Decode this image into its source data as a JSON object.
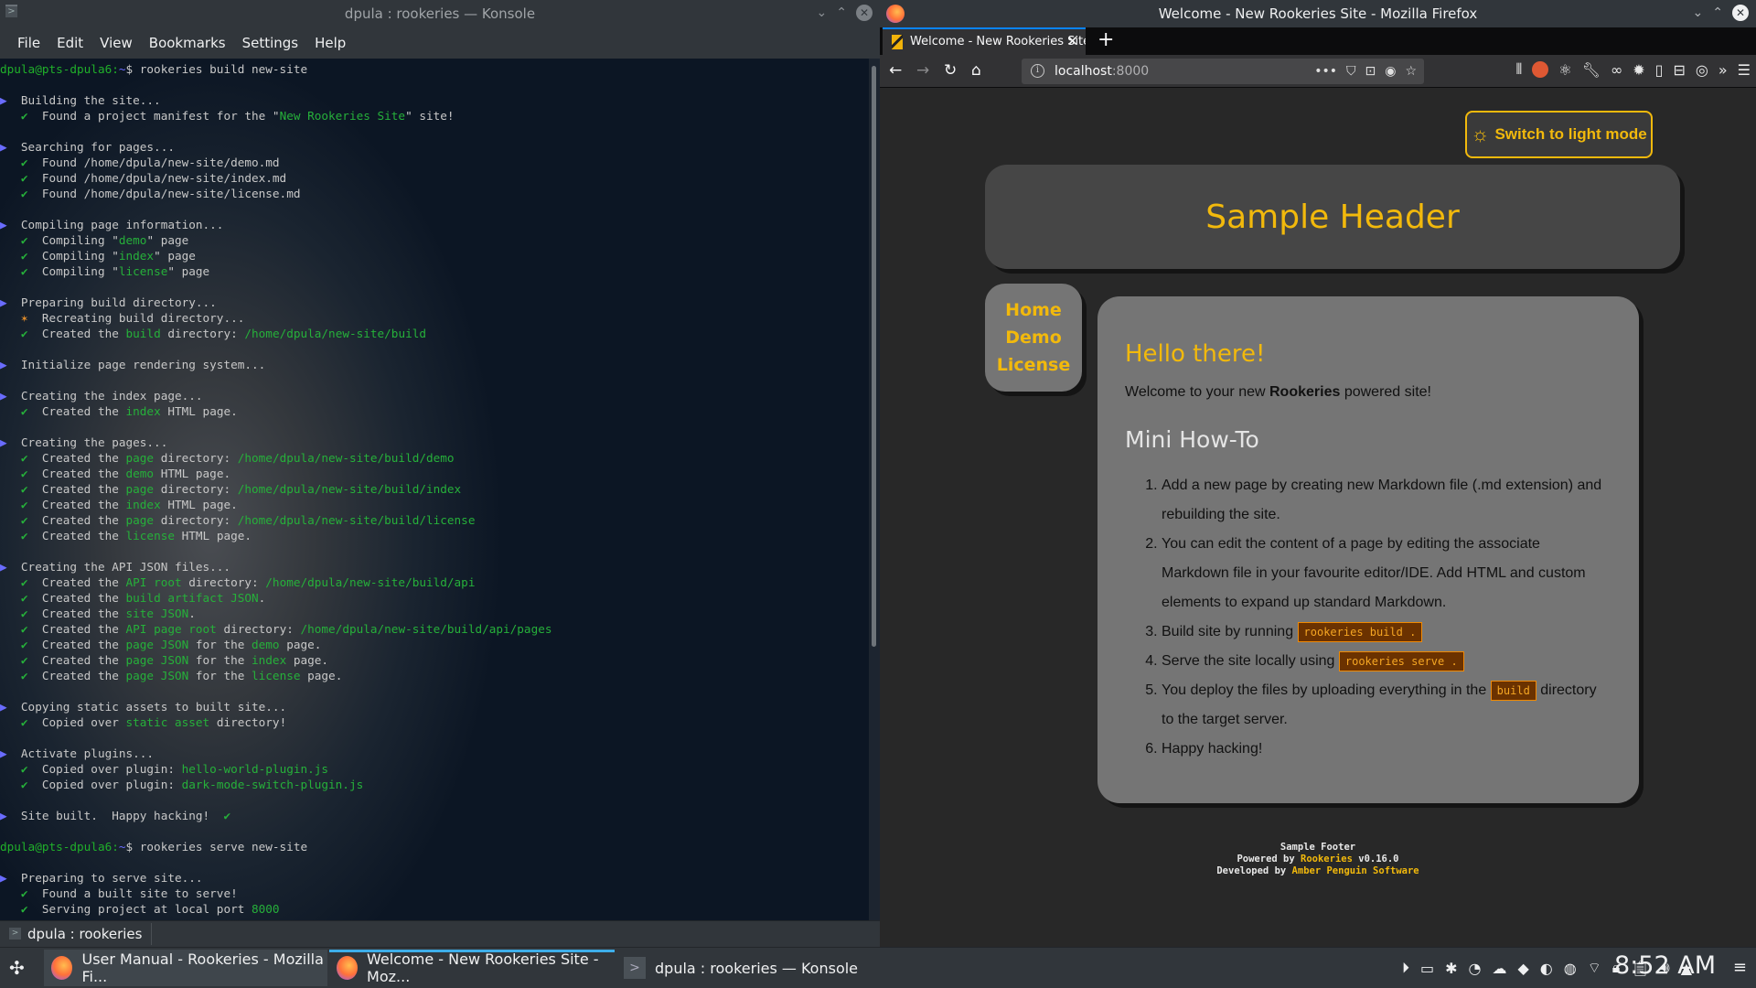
{
  "konsole": {
    "title": "dpula : rookeries — Konsole",
    "menu": [
      "File",
      "Edit",
      "View",
      "Bookmarks",
      "Settings",
      "Help"
    ],
    "tab_label": "dpula : rookeries",
    "lines": [
      [
        {
          "t": "dpula@pts-dpula6:",
          "c": "p"
        },
        {
          "t": "~",
          "c": "b"
        },
        {
          "t": "$ rookeries build new-site",
          "c": ""
        }
      ],
      [],
      [
        {
          "t": "▶ ",
          "c": "b"
        },
        {
          "t": " Building the site...",
          "c": ""
        }
      ],
      [
        {
          "t": "   ✔ ",
          "c": "g"
        },
        {
          "t": " Found a project manifest for the \"",
          "c": ""
        },
        {
          "t": "New Rookeries Site",
          "c": "g"
        },
        {
          "t": "\" site!",
          "c": ""
        }
      ],
      [],
      [
        {
          "t": "▶ ",
          "c": "b"
        },
        {
          "t": " Searching for pages...",
          "c": ""
        }
      ],
      [
        {
          "t": "   ✔ ",
          "c": "g"
        },
        {
          "t": " Found /home/dpula/new-site/demo.md",
          "c": ""
        }
      ],
      [
        {
          "t": "   ✔ ",
          "c": "g"
        },
        {
          "t": " Found /home/dpula/new-site/index.md",
          "c": ""
        }
      ],
      [
        {
          "t": "   ✔ ",
          "c": "g"
        },
        {
          "t": " Found /home/dpula/new-site/license.md",
          "c": ""
        }
      ],
      [],
      [
        {
          "t": "▶ ",
          "c": "b"
        },
        {
          "t": " Compiling page information...",
          "c": ""
        }
      ],
      [
        {
          "t": "   ✔ ",
          "c": "g"
        },
        {
          "t": " Compiling \"",
          "c": ""
        },
        {
          "t": "demo",
          "c": "g"
        },
        {
          "t": "\" page",
          "c": ""
        }
      ],
      [
        {
          "t": "   ✔ ",
          "c": "g"
        },
        {
          "t": " Compiling \"",
          "c": ""
        },
        {
          "t": "index",
          "c": "g"
        },
        {
          "t": "\" page",
          "c": ""
        }
      ],
      [
        {
          "t": "   ✔ ",
          "c": "g"
        },
        {
          "t": " Compiling \"",
          "c": ""
        },
        {
          "t": "license",
          "c": "g"
        },
        {
          "t": "\" page",
          "c": ""
        }
      ],
      [],
      [
        {
          "t": "▶ ",
          "c": "b"
        },
        {
          "t": " Preparing build directory...",
          "c": ""
        }
      ],
      [
        {
          "t": "   ✶ ",
          "c": "o"
        },
        {
          "t": " Recreating build directory...",
          "c": ""
        }
      ],
      [
        {
          "t": "   ✔ ",
          "c": "g"
        },
        {
          "t": " Created the ",
          "c": ""
        },
        {
          "t": "build",
          "c": "g"
        },
        {
          "t": " directory: ",
          "c": ""
        },
        {
          "t": "/home/dpula/new-site/build",
          "c": "g"
        }
      ],
      [],
      [
        {
          "t": "▶ ",
          "c": "b"
        },
        {
          "t": " Initialize page rendering system...",
          "c": ""
        }
      ],
      [],
      [
        {
          "t": "▶ ",
          "c": "b"
        },
        {
          "t": " Creating the index page...",
          "c": ""
        }
      ],
      [
        {
          "t": "   ✔ ",
          "c": "g"
        },
        {
          "t": " Created the ",
          "c": ""
        },
        {
          "t": "index",
          "c": "g"
        },
        {
          "t": " HTML page.",
          "c": ""
        }
      ],
      [],
      [
        {
          "t": "▶ ",
          "c": "b"
        },
        {
          "t": " Creating the pages...",
          "c": ""
        }
      ],
      [
        {
          "t": "   ✔ ",
          "c": "g"
        },
        {
          "t": " Created the ",
          "c": ""
        },
        {
          "t": "page",
          "c": "g"
        },
        {
          "t": " directory: ",
          "c": ""
        },
        {
          "t": "/home/dpula/new-site/build/demo",
          "c": "g"
        }
      ],
      [
        {
          "t": "   ✔ ",
          "c": "g"
        },
        {
          "t": " Created the ",
          "c": ""
        },
        {
          "t": "demo",
          "c": "g"
        },
        {
          "t": " HTML page.",
          "c": ""
        }
      ],
      [
        {
          "t": "   ✔ ",
          "c": "g"
        },
        {
          "t": " Created the ",
          "c": ""
        },
        {
          "t": "page",
          "c": "g"
        },
        {
          "t": " directory: ",
          "c": ""
        },
        {
          "t": "/home/dpula/new-site/build/index",
          "c": "g"
        }
      ],
      [
        {
          "t": "   ✔ ",
          "c": "g"
        },
        {
          "t": " Created the ",
          "c": ""
        },
        {
          "t": "index",
          "c": "g"
        },
        {
          "t": " HTML page.",
          "c": ""
        }
      ],
      [
        {
          "t": "   ✔ ",
          "c": "g"
        },
        {
          "t": " Created the ",
          "c": ""
        },
        {
          "t": "page",
          "c": "g"
        },
        {
          "t": " directory: ",
          "c": ""
        },
        {
          "t": "/home/dpula/new-site/build/license",
          "c": "g"
        }
      ],
      [
        {
          "t": "   ✔ ",
          "c": "g"
        },
        {
          "t": " Created the ",
          "c": ""
        },
        {
          "t": "license",
          "c": "g"
        },
        {
          "t": " HTML page.",
          "c": ""
        }
      ],
      [],
      [
        {
          "t": "▶ ",
          "c": "b"
        },
        {
          "t": " Creating the API JSON files...",
          "c": ""
        }
      ],
      [
        {
          "t": "   ✔ ",
          "c": "g"
        },
        {
          "t": " Created the ",
          "c": ""
        },
        {
          "t": "API root",
          "c": "g"
        },
        {
          "t": " directory: ",
          "c": ""
        },
        {
          "t": "/home/dpula/new-site/build/api",
          "c": "g"
        }
      ],
      [
        {
          "t": "   ✔ ",
          "c": "g"
        },
        {
          "t": " Created the ",
          "c": ""
        },
        {
          "t": "build artifact JSON",
          "c": "g"
        },
        {
          "t": ".",
          "c": ""
        }
      ],
      [
        {
          "t": "   ✔ ",
          "c": "g"
        },
        {
          "t": " Created the ",
          "c": ""
        },
        {
          "t": "site JSON",
          "c": "g"
        },
        {
          "t": ".",
          "c": ""
        }
      ],
      [
        {
          "t": "   ✔ ",
          "c": "g"
        },
        {
          "t": " Created the ",
          "c": ""
        },
        {
          "t": "API page root",
          "c": "g"
        },
        {
          "t": " directory: ",
          "c": ""
        },
        {
          "t": "/home/dpula/new-site/build/api/pages",
          "c": "g"
        }
      ],
      [
        {
          "t": "   ✔ ",
          "c": "g"
        },
        {
          "t": " Created the ",
          "c": ""
        },
        {
          "t": "page JSON",
          "c": "g"
        },
        {
          "t": " for the ",
          "c": ""
        },
        {
          "t": "demo",
          "c": "g"
        },
        {
          "t": " page.",
          "c": ""
        }
      ],
      [
        {
          "t": "   ✔ ",
          "c": "g"
        },
        {
          "t": " Created the ",
          "c": ""
        },
        {
          "t": "page JSON",
          "c": "g"
        },
        {
          "t": " for the ",
          "c": ""
        },
        {
          "t": "index",
          "c": "g"
        },
        {
          "t": " page.",
          "c": ""
        }
      ],
      [
        {
          "t": "   ✔ ",
          "c": "g"
        },
        {
          "t": " Created the ",
          "c": ""
        },
        {
          "t": "page JSON",
          "c": "g"
        },
        {
          "t": " for the ",
          "c": ""
        },
        {
          "t": "license",
          "c": "g"
        },
        {
          "t": " page.",
          "c": ""
        }
      ],
      [],
      [
        {
          "t": "▶ ",
          "c": "b"
        },
        {
          "t": " Copying static assets to built site...",
          "c": ""
        }
      ],
      [
        {
          "t": "   ✔ ",
          "c": "g"
        },
        {
          "t": " Copied over ",
          "c": ""
        },
        {
          "t": "static asset",
          "c": "g"
        },
        {
          "t": " directory!",
          "c": ""
        }
      ],
      [],
      [
        {
          "t": "▶ ",
          "c": "b"
        },
        {
          "t": " Activate plugins...",
          "c": ""
        }
      ],
      [
        {
          "t": "   ✔ ",
          "c": "g"
        },
        {
          "t": " Copied over plugin: ",
          "c": ""
        },
        {
          "t": "hello-world-plugin.js",
          "c": "g"
        }
      ],
      [
        {
          "t": "   ✔ ",
          "c": "g"
        },
        {
          "t": " Copied over plugin: ",
          "c": ""
        },
        {
          "t": "dark-mode-switch-plugin.js",
          "c": "g"
        }
      ],
      [],
      [
        {
          "t": "▶ ",
          "c": "b"
        },
        {
          "t": " Site built.  Happy hacking!  ",
          "c": ""
        },
        {
          "t": "✔",
          "c": "g"
        }
      ],
      [],
      [
        {
          "t": "dpula@pts-dpula6:",
          "c": "p"
        },
        {
          "t": "~",
          "c": "b"
        },
        {
          "t": "$ rookeries serve new-site",
          "c": ""
        }
      ],
      [],
      [
        {
          "t": "▶ ",
          "c": "b"
        },
        {
          "t": " Preparing to serve site...",
          "c": ""
        }
      ],
      [
        {
          "t": "   ✔ ",
          "c": "g"
        },
        {
          "t": " Found a built site to serve!",
          "c": ""
        }
      ],
      [
        {
          "t": "   ✔ ",
          "c": "g"
        },
        {
          "t": " Serving project at local port ",
          "c": ""
        },
        {
          "t": "8000",
          "c": "g"
        }
      ]
    ]
  },
  "firefox": {
    "title": "Welcome - New Rookeries Site - Mozilla Firefox",
    "tab_title": "Welcome - New Rookeries Site",
    "url_host": "localhost",
    "url_port": ":8000"
  },
  "page": {
    "mode_button": "Switch to light mode",
    "header": "Sample Header",
    "nav": [
      "Home",
      "Demo",
      "License"
    ],
    "heading": "Hello there!",
    "welcome_pre": "Welcome to your new ",
    "welcome_bold": "Rookeries",
    "welcome_post": " powered site!",
    "subheading": "Mini How-To",
    "steps": {
      "s1": "Add a new page by creating new Markdown file (.md extension) and rebuilding the site.",
      "s2": "You can edit the content of a page by editing the associate Markdown file in your favourite editor/IDE. Add HTML and custom elements to expand up standard Markdown.",
      "s3_pre": "Build site by running ",
      "s3_code": "rookeries build .",
      "s4_pre": "Serve the site locally using ",
      "s4_code": "rookeries serve .",
      "s5_pre": "You deploy the files by uploading everything in the ",
      "s5_code": "build",
      "s5_post": " directory to the target server.",
      "s6": "Happy hacking!"
    },
    "footer": {
      "line1": "Sample Footer",
      "powered_by": "Powered by ",
      "powered_name": "Rookeries",
      "version": " v0.16.0",
      "developed_by": "Developed by ",
      "developer": "Amber Penguin Software"
    }
  },
  "taskbar": {
    "tasks": [
      "User Manual - Rookeries - Mozilla Fi...",
      "Welcome - New Rookeries Site - Moz...",
      "dpula : rookeries — Konsole"
    ],
    "clock": "8:52 AM"
  }
}
